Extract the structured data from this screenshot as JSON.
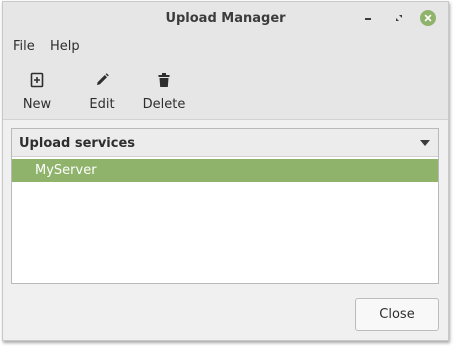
{
  "window": {
    "title": "Upload Manager"
  },
  "menubar": {
    "items": [
      {
        "label": "File"
      },
      {
        "label": "Help"
      }
    ]
  },
  "toolbar": {
    "new_label": "New",
    "new_icon": "add-icon",
    "edit_label": "Edit",
    "edit_icon": "pencil-icon",
    "delete_label": "Delete",
    "delete_icon": "trash-icon"
  },
  "services": {
    "header_label": "Upload services",
    "items": [
      {
        "label": "MyServer",
        "selected": true
      }
    ]
  },
  "footer": {
    "close_label": "Close"
  },
  "colors": {
    "accent": "#8fb36b",
    "titlebar": "#e6e6e6",
    "window_bg": "#f0f0f0"
  }
}
